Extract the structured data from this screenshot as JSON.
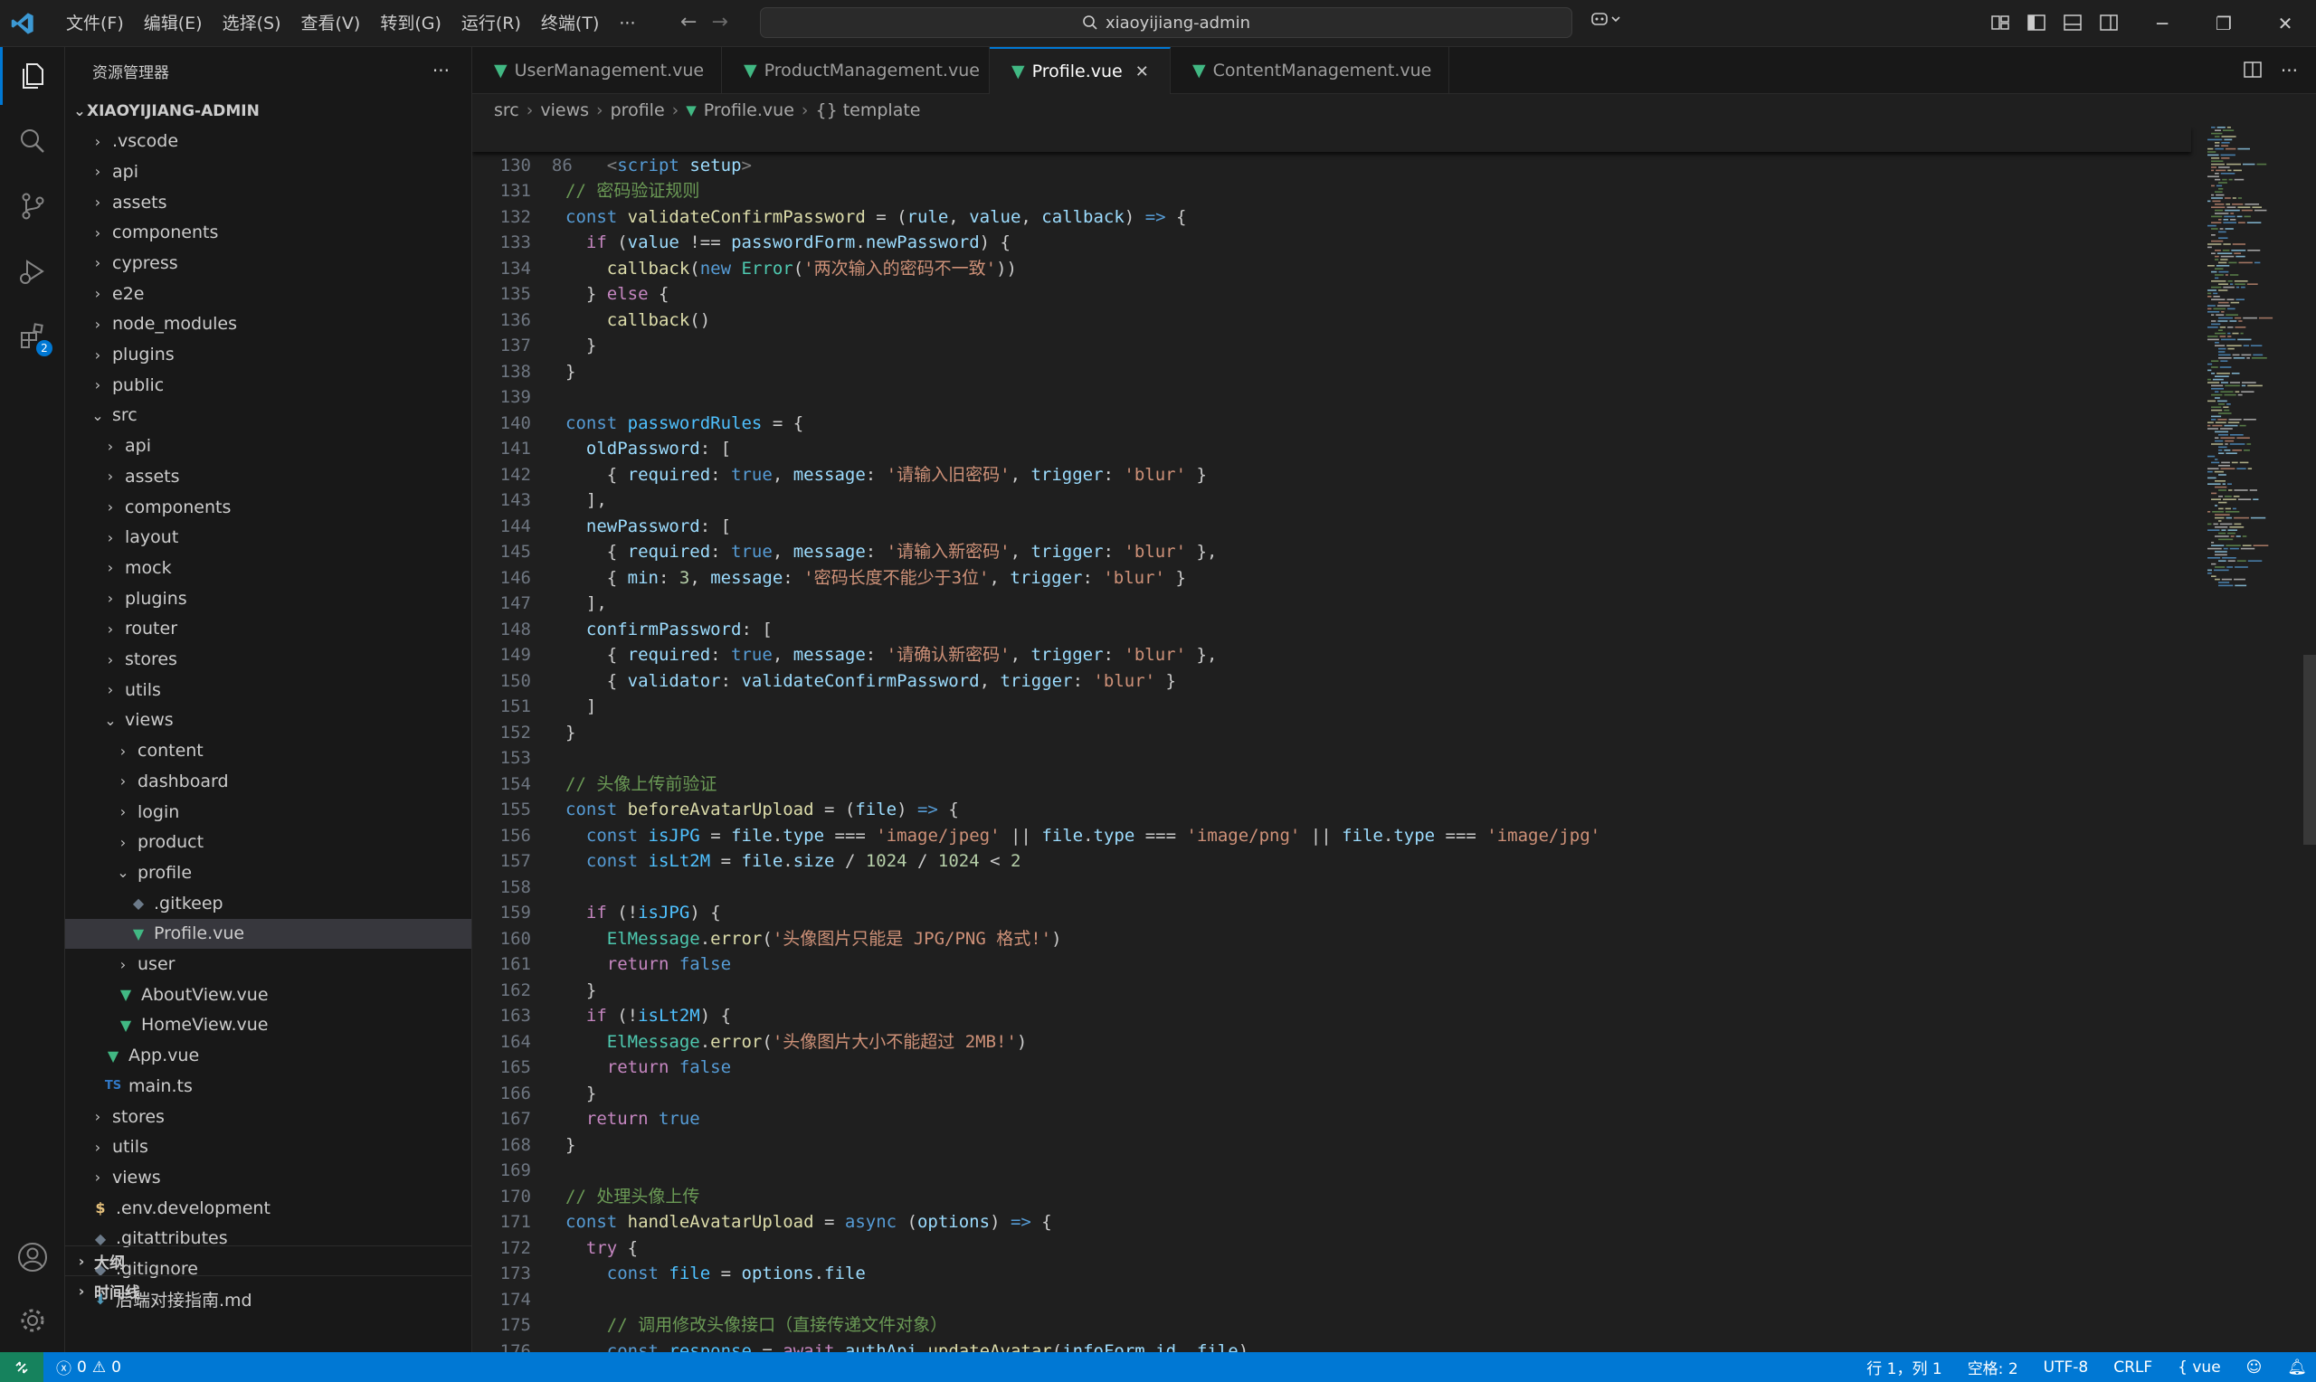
{
  "titlebar": {
    "menu": [
      "文件(F)",
      "编辑(E)",
      "选择(S)",
      "查看(V)",
      "转到(G)",
      "运行(R)",
      "终端(T)",
      "···"
    ],
    "search_text": "xiaoyijiang-admin"
  },
  "sidebar": {
    "title": "资源管理器",
    "more": "···",
    "root": "XIAOYIJIANG-ADMIN",
    "items": [
      {
        "label": ".vscode",
        "kind": "folder",
        "depth": 1,
        "open": false
      },
      {
        "label": "api",
        "kind": "folder",
        "depth": 1,
        "open": false
      },
      {
        "label": "assets",
        "kind": "folder",
        "depth": 1,
        "open": false
      },
      {
        "label": "components",
        "kind": "folder",
        "depth": 1,
        "open": false
      },
      {
        "label": "cypress",
        "kind": "folder",
        "depth": 1,
        "open": false
      },
      {
        "label": "e2e",
        "kind": "folder",
        "depth": 1,
        "open": false
      },
      {
        "label": "node_modules",
        "kind": "folder",
        "depth": 1,
        "open": false
      },
      {
        "label": "plugins",
        "kind": "folder",
        "depth": 1,
        "open": false
      },
      {
        "label": "public",
        "kind": "folder",
        "depth": 1,
        "open": false
      },
      {
        "label": "src",
        "kind": "folder",
        "depth": 1,
        "open": true
      },
      {
        "label": "api",
        "kind": "folder",
        "depth": 2,
        "open": false
      },
      {
        "label": "assets",
        "kind": "folder",
        "depth": 2,
        "open": false
      },
      {
        "label": "components",
        "kind": "folder",
        "depth": 2,
        "open": false
      },
      {
        "label": "layout",
        "kind": "folder",
        "depth": 2,
        "open": false
      },
      {
        "label": "mock",
        "kind": "folder",
        "depth": 2,
        "open": false
      },
      {
        "label": "plugins",
        "kind": "folder",
        "depth": 2,
        "open": false
      },
      {
        "label": "router",
        "kind": "folder",
        "depth": 2,
        "open": false
      },
      {
        "label": "stores",
        "kind": "folder",
        "depth": 2,
        "open": false
      },
      {
        "label": "utils",
        "kind": "folder",
        "depth": 2,
        "open": false
      },
      {
        "label": "views",
        "kind": "folder",
        "depth": 2,
        "open": true
      },
      {
        "label": "content",
        "kind": "folder",
        "depth": 3,
        "open": false
      },
      {
        "label": "dashboard",
        "kind": "folder",
        "depth": 3,
        "open": false
      },
      {
        "label": "login",
        "kind": "folder",
        "depth": 3,
        "open": false
      },
      {
        "label": "product",
        "kind": "folder",
        "depth": 3,
        "open": false
      },
      {
        "label": "profile",
        "kind": "folder",
        "depth": 3,
        "open": true
      },
      {
        "label": ".gitkeep",
        "kind": "git",
        "depth": 4
      },
      {
        "label": "Profile.vue",
        "kind": "vue",
        "depth": 4,
        "selected": true
      },
      {
        "label": "user",
        "kind": "folder",
        "depth": 3,
        "open": false
      },
      {
        "label": "AboutView.vue",
        "kind": "vue",
        "depth": 3
      },
      {
        "label": "HomeView.vue",
        "kind": "vue",
        "depth": 3
      },
      {
        "label": "App.vue",
        "kind": "vue",
        "depth": 2
      },
      {
        "label": "main.ts",
        "kind": "ts",
        "depth": 2
      },
      {
        "label": "stores",
        "kind": "folder",
        "depth": 1,
        "open": false
      },
      {
        "label": "utils",
        "kind": "folder",
        "depth": 1,
        "open": false
      },
      {
        "label": "views",
        "kind": "folder",
        "depth": 1,
        "open": false
      },
      {
        "label": ".env.development",
        "kind": "env",
        "depth": 1
      },
      {
        "label": ".gitattributes",
        "kind": "git",
        "depth": 1
      },
      {
        "label": ".gitignore",
        "kind": "git",
        "depth": 1
      },
      {
        "label": "后端对接指南.md",
        "kind": "md",
        "depth": 1
      }
    ],
    "panels": [
      "大纲",
      "时间线"
    ]
  },
  "activity_bar": {
    "items": [
      "explorer-icon",
      "search-icon",
      "source-control-icon",
      "run-debug-icon",
      "extensions-icon"
    ],
    "extensions_badge": "2"
  },
  "tabs": [
    {
      "label": "UserManagement.vue",
      "active": false
    },
    {
      "label": "ProductManagement.vue",
      "active": false
    },
    {
      "label": "Profile.vue",
      "active": true
    },
    {
      "label": "ContentManagement.vue",
      "active": false
    }
  ],
  "breadcrumb": [
    "src",
    "views",
    "profile",
    "Profile.vue",
    "{} template"
  ],
  "editor": {
    "sticky_line": {
      "n": "86"
    },
    "first_line": 130
  },
  "statusbar": {
    "errors": "0",
    "warnings": "0",
    "position": "行 1，列 1",
    "spaces": "空格: 2",
    "encoding": "UTF-8",
    "eol": "CRLF",
    "language": "vue"
  },
  "colors": {
    "accent": "#0078d4",
    "vue": "#41b883",
    "statusbar": "#0078d4"
  }
}
